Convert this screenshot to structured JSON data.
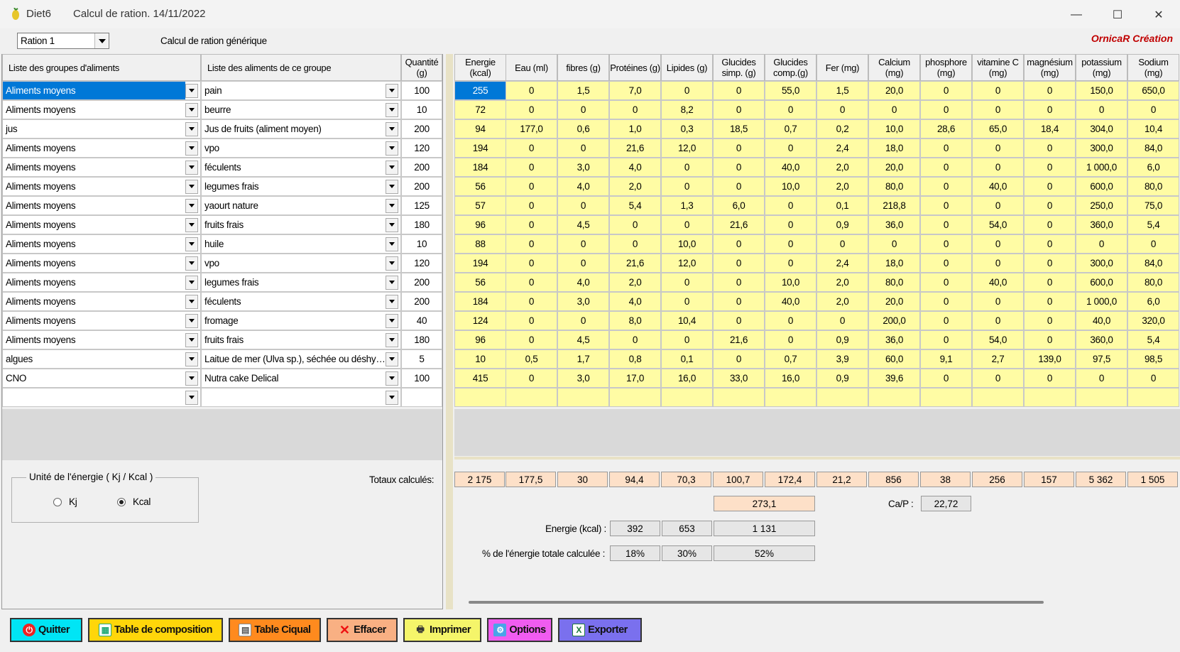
{
  "window": {
    "app_title": "Diet6",
    "doc_title": "Calcul de ration.  14/11/2022",
    "minimize": "—",
    "maximize": "☐",
    "close": "✕"
  },
  "topbar": {
    "ration_select": "Ration 1",
    "subtitle": "Calcul de ration générique",
    "brand": "OrnicaR Création"
  },
  "left_headers": {
    "groups": "Liste des groupes d'aliments",
    "foods": "Liste des aliments de ce groupe",
    "quantity": "Quantité (g)"
  },
  "nutrient_headers": [
    "Energie (kcal)",
    "Eau (ml)",
    "fibres  (g)",
    "Protéines (g)",
    "Lipides (g)",
    "Glucides simp. (g)",
    "Glucides comp.(g)",
    "Fer (mg)",
    "Calcium (mg)",
    "phosphore (mg)",
    "vitamine C (mg)",
    "magnésium (mg)",
    "potassium (mg)",
    "Sodium (mg)"
  ],
  "rows": [
    {
      "group": "Aliments moyens",
      "food": "pain",
      "qty": "100",
      "values": [
        "255",
        "0",
        "1,5",
        "7,0",
        "0",
        "0",
        "55,0",
        "1,5",
        "20,0",
        "0",
        "0",
        "0",
        "150,0",
        "650,0"
      ]
    },
    {
      "group": "Aliments moyens",
      "food": "beurre",
      "qty": "10",
      "values": [
        "72",
        "0",
        "0",
        "0",
        "8,2",
        "0",
        "0",
        "0",
        "0",
        "0",
        "0",
        "0",
        "0",
        "0"
      ]
    },
    {
      "group": "jus",
      "food": "Jus de fruits (aliment moyen)",
      "qty": "200",
      "values": [
        "94",
        "177,0",
        "0,6",
        "1,0",
        "0,3",
        "18,5",
        "0,7",
        "0,2",
        "10,0",
        "28,6",
        "65,0",
        "18,4",
        "304,0",
        "10,4"
      ]
    },
    {
      "group": "Aliments moyens",
      "food": "vpo",
      "qty": "120",
      "values": [
        "194",
        "0",
        "0",
        "21,6",
        "12,0",
        "0",
        "0",
        "2,4",
        "18,0",
        "0",
        "0",
        "0",
        "300,0",
        "84,0"
      ]
    },
    {
      "group": "Aliments moyens",
      "food": "féculents",
      "qty": "200",
      "values": [
        "184",
        "0",
        "3,0",
        "4,0",
        "0",
        "0",
        "40,0",
        "2,0",
        "20,0",
        "0",
        "0",
        "0",
        "1 000,0",
        "6,0"
      ]
    },
    {
      "group": "Aliments moyens",
      "food": "legumes frais",
      "qty": "200",
      "values": [
        "56",
        "0",
        "4,0",
        "2,0",
        "0",
        "0",
        "10,0",
        "2,0",
        "80,0",
        "0",
        "40,0",
        "0",
        "600,0",
        "80,0"
      ]
    },
    {
      "group": "Aliments moyens",
      "food": "yaourt nature",
      "qty": "125",
      "values": [
        "57",
        "0",
        "0",
        "5,4",
        "1,3",
        "6,0",
        "0",
        "0,1",
        "218,8",
        "0",
        "0",
        "0",
        "250,0",
        "75,0"
      ]
    },
    {
      "group": "Aliments moyens",
      "food": "fruits frais",
      "qty": "180",
      "values": [
        "96",
        "0",
        "4,5",
        "0",
        "0",
        "21,6",
        "0",
        "0,9",
        "36,0",
        "0",
        "54,0",
        "0",
        "360,0",
        "5,4"
      ]
    },
    {
      "group": "Aliments moyens",
      "food": "huile",
      "qty": "10",
      "values": [
        "88",
        "0",
        "0",
        "0",
        "10,0",
        "0",
        "0",
        "0",
        "0",
        "0",
        "0",
        "0",
        "0",
        "0"
      ]
    },
    {
      "group": "Aliments moyens",
      "food": "vpo",
      "qty": "120",
      "values": [
        "194",
        "0",
        "0",
        "21,6",
        "12,0",
        "0",
        "0",
        "2,4",
        "18,0",
        "0",
        "0",
        "0",
        "300,0",
        "84,0"
      ]
    },
    {
      "group": "Aliments moyens",
      "food": "legumes frais",
      "qty": "200",
      "values": [
        "56",
        "0",
        "4,0",
        "2,0",
        "0",
        "0",
        "10,0",
        "2,0",
        "80,0",
        "0",
        "40,0",
        "0",
        "600,0",
        "80,0"
      ]
    },
    {
      "group": "Aliments moyens",
      "food": "féculents",
      "qty": "200",
      "values": [
        "184",
        "0",
        "3,0",
        "4,0",
        "0",
        "0",
        "40,0",
        "2,0",
        "20,0",
        "0",
        "0",
        "0",
        "1 000,0",
        "6,0"
      ]
    },
    {
      "group": "Aliments moyens",
      "food": "fromage",
      "qty": "40",
      "values": [
        "124",
        "0",
        "0",
        "8,0",
        "10,4",
        "0",
        "0",
        "0",
        "200,0",
        "0",
        "0",
        "0",
        "40,0",
        "320,0"
      ]
    },
    {
      "group": "Aliments moyens",
      "food": "fruits frais",
      "qty": "180",
      "values": [
        "96",
        "0",
        "4,5",
        "0",
        "0",
        "21,6",
        "0",
        "0,9",
        "36,0",
        "0",
        "54,0",
        "0",
        "360,0",
        "5,4"
      ]
    },
    {
      "group": "algues",
      "food": "Laitue de mer (Ulva sp.), séchée ou déshydratée",
      "qty": "5",
      "values": [
        "10",
        "0,5",
        "1,7",
        "0,8",
        "0,1",
        "0",
        "0,7",
        "3,9",
        "60,0",
        "9,1",
        "2,7",
        "139,0",
        "97,5",
        "98,5"
      ]
    },
    {
      "group": "CNO",
      "food": "Nutra cake Delical",
      "qty": "100",
      "values": [
        "415",
        "0",
        "3,0",
        "17,0",
        "16,0",
        "33,0",
        "16,0",
        "0,9",
        "39,6",
        "0",
        "0",
        "0",
        "0",
        "0"
      ]
    },
    {
      "group": "",
      "food": "",
      "qty": "",
      "values": [
        "",
        "",
        "",
        "",
        "",
        "",
        "",
        "",
        "",
        "",
        "",
        "",
        "",
        ""
      ]
    }
  ],
  "totals": {
    "label": "Totaux calculés:",
    "values": [
      "2 175",
      "177,5",
      "30",
      "94,4",
      "70,3",
      "100,7",
      "172,4",
      "21,2",
      "856",
      "38",
      "256",
      "157",
      "5 362",
      "1 505"
    ],
    "glucides_total": "273,1",
    "cap_label": "Ca/P :",
    "cap_value": "22,72",
    "energy_label": "Energie (kcal) :",
    "energy_values": [
      "392",
      "653",
      "1 131"
    ],
    "pct_label": "% de l'énergie totale calculée :",
    "pct_values": [
      "18%",
      "30%",
      "52%"
    ]
  },
  "energy_unit": {
    "title": "Unité de l'énergie ( Kj / Kcal )",
    "kj": "Kj",
    "kcal": "Kcal",
    "selected": "Kcal"
  },
  "buttons": {
    "quit": "Quitter",
    "table_comp": "Table de composition",
    "table_ciqual": "Table Ciqual",
    "erase": "Effacer",
    "print": "Imprimer",
    "options": "Options",
    "export": "Exporter"
  },
  "colors": {
    "cell_yellow": "#fffca4",
    "total_peach": "#fde0c8",
    "selection": "#0078d7",
    "brand_red": "#c00000"
  }
}
